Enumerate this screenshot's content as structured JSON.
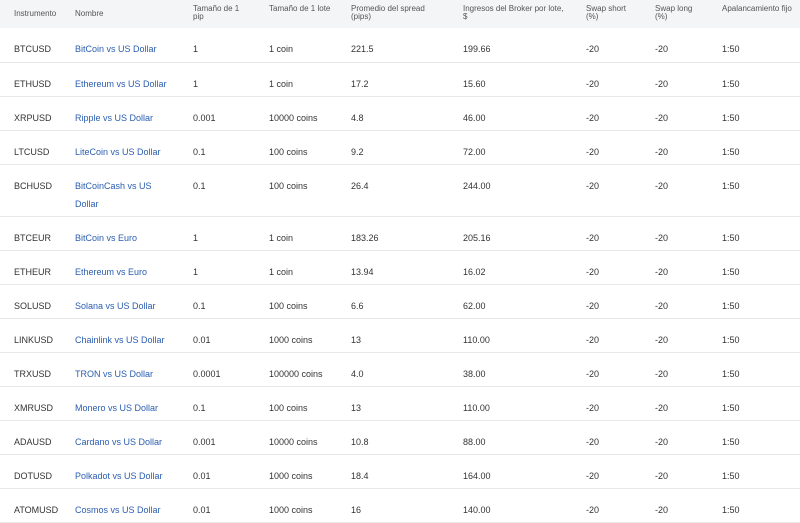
{
  "table": {
    "headers": [
      "Instrumento",
      "Nombre",
      "Tamaño de 1 pip",
      "Tamaño de 1 lote",
      "Promedio del spread (pips)",
      "Ingresos del Broker por lote, $",
      "Swap short (%)",
      "Swap long (%)",
      "Apalancamiento fijo"
    ],
    "rows": [
      [
        "BTCUSD",
        "BitCoin vs US Dollar",
        "1",
        "1 coin",
        "221.5",
        "199.66",
        "-20",
        "-20",
        "1:50"
      ],
      [
        "ETHUSD",
        "Ethereum vs US Dollar",
        "1",
        "1 coin",
        "17.2",
        "15.60",
        "-20",
        "-20",
        "1:50"
      ],
      [
        "XRPUSD",
        "Ripple vs US Dollar",
        "0.001",
        "10000 coins",
        "4.8",
        "46.00",
        "-20",
        "-20",
        "1:50"
      ],
      [
        "LTCUSD",
        "LiteCoin vs US Dollar",
        "0.1",
        "100 coins",
        "9.2",
        "72.00",
        "-20",
        "-20",
        "1:50"
      ],
      [
        "BCHUSD",
        "BitCoinCash vs US Dollar",
        "0.1",
        "100 coins",
        "26.4",
        "244.00",
        "-20",
        "-20",
        "1:50"
      ],
      [
        "BTCEUR",
        "BitCoin vs Euro",
        "1",
        "1 coin",
        "183.26",
        "205.16",
        "-20",
        "-20",
        "1:50"
      ],
      [
        "ETHEUR",
        "Ethereum vs Euro",
        "1",
        "1 coin",
        "13.94",
        "16.02",
        "-20",
        "-20",
        "1:50"
      ],
      [
        "SOLUSD",
        "Solana vs US Dollar",
        "0.1",
        "100 coins",
        "6.6",
        "62.00",
        "-20",
        "-20",
        "1:50"
      ],
      [
        "LINKUSD",
        "Chainlink vs US Dollar",
        "0.01",
        "1000 coins",
        "13",
        "110.00",
        "-20",
        "-20",
        "1:50"
      ],
      [
        "TRXUSD",
        "TRON vs US Dollar",
        "0.0001",
        "100000 coins",
        "4.0",
        "38.00",
        "-20",
        "-20",
        "1:50"
      ],
      [
        "XMRUSD",
        "Monero vs US Dollar",
        "0.1",
        "100 coins",
        "13",
        "110.00",
        "-20",
        "-20",
        "1:50"
      ],
      [
        "ADAUSD",
        "Cardano vs US Dollar",
        "0.001",
        "10000 coins",
        "10.8",
        "88.00",
        "-20",
        "-20",
        "1:50"
      ],
      [
        "DOTUSD",
        "Polkadot vs US Dollar",
        "0.01",
        "1000 coins",
        "18.4",
        "164.00",
        "-20",
        "-20",
        "1:50"
      ],
      [
        "ATOMUSD",
        "Cosmos vs US Dollar",
        "0.01",
        "1000 coins",
        "16",
        "140.00",
        "-20",
        "-20",
        "1:50"
      ]
    ]
  },
  "colors": {
    "header_bg": "#f4f5f7",
    "link": "#2a5db0",
    "text": "#333333",
    "divider": "#e8e8e8"
  }
}
